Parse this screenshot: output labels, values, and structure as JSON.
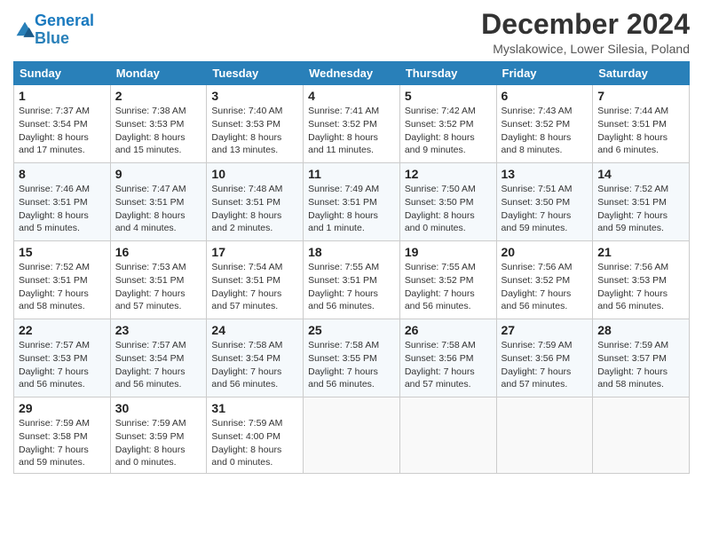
{
  "header": {
    "logo_line1": "General",
    "logo_line2": "Blue",
    "month_title": "December 2024",
    "location": "Myslakowice, Lower Silesia, Poland"
  },
  "weekdays": [
    "Sunday",
    "Monday",
    "Tuesday",
    "Wednesday",
    "Thursday",
    "Friday",
    "Saturday"
  ],
  "weeks": [
    [
      {
        "day": "1",
        "sunrise": "7:37 AM",
        "sunset": "3:54 PM",
        "daylight": "8 hours and 17 minutes."
      },
      {
        "day": "2",
        "sunrise": "7:38 AM",
        "sunset": "3:53 PM",
        "daylight": "8 hours and 15 minutes."
      },
      {
        "day": "3",
        "sunrise": "7:40 AM",
        "sunset": "3:53 PM",
        "daylight": "8 hours and 13 minutes."
      },
      {
        "day": "4",
        "sunrise": "7:41 AM",
        "sunset": "3:52 PM",
        "daylight": "8 hours and 11 minutes."
      },
      {
        "day": "5",
        "sunrise": "7:42 AM",
        "sunset": "3:52 PM",
        "daylight": "8 hours and 9 minutes."
      },
      {
        "day": "6",
        "sunrise": "7:43 AM",
        "sunset": "3:52 PM",
        "daylight": "8 hours and 8 minutes."
      },
      {
        "day": "7",
        "sunrise": "7:44 AM",
        "sunset": "3:51 PM",
        "daylight": "8 hours and 6 minutes."
      }
    ],
    [
      {
        "day": "8",
        "sunrise": "7:46 AM",
        "sunset": "3:51 PM",
        "daylight": "8 hours and 5 minutes."
      },
      {
        "day": "9",
        "sunrise": "7:47 AM",
        "sunset": "3:51 PM",
        "daylight": "8 hours and 4 minutes."
      },
      {
        "day": "10",
        "sunrise": "7:48 AM",
        "sunset": "3:51 PM",
        "daylight": "8 hours and 2 minutes."
      },
      {
        "day": "11",
        "sunrise": "7:49 AM",
        "sunset": "3:51 PM",
        "daylight": "8 hours and 1 minute."
      },
      {
        "day": "12",
        "sunrise": "7:50 AM",
        "sunset": "3:50 PM",
        "daylight": "8 hours and 0 minutes."
      },
      {
        "day": "13",
        "sunrise": "7:51 AM",
        "sunset": "3:50 PM",
        "daylight": "7 hours and 59 minutes."
      },
      {
        "day": "14",
        "sunrise": "7:52 AM",
        "sunset": "3:51 PM",
        "daylight": "7 hours and 59 minutes."
      }
    ],
    [
      {
        "day": "15",
        "sunrise": "7:52 AM",
        "sunset": "3:51 PM",
        "daylight": "7 hours and 58 minutes."
      },
      {
        "day": "16",
        "sunrise": "7:53 AM",
        "sunset": "3:51 PM",
        "daylight": "7 hours and 57 minutes."
      },
      {
        "day": "17",
        "sunrise": "7:54 AM",
        "sunset": "3:51 PM",
        "daylight": "7 hours and 57 minutes."
      },
      {
        "day": "18",
        "sunrise": "7:55 AM",
        "sunset": "3:51 PM",
        "daylight": "7 hours and 56 minutes."
      },
      {
        "day": "19",
        "sunrise": "7:55 AM",
        "sunset": "3:52 PM",
        "daylight": "7 hours and 56 minutes."
      },
      {
        "day": "20",
        "sunrise": "7:56 AM",
        "sunset": "3:52 PM",
        "daylight": "7 hours and 56 minutes."
      },
      {
        "day": "21",
        "sunrise": "7:56 AM",
        "sunset": "3:53 PM",
        "daylight": "7 hours and 56 minutes."
      }
    ],
    [
      {
        "day": "22",
        "sunrise": "7:57 AM",
        "sunset": "3:53 PM",
        "daylight": "7 hours and 56 minutes."
      },
      {
        "day": "23",
        "sunrise": "7:57 AM",
        "sunset": "3:54 PM",
        "daylight": "7 hours and 56 minutes."
      },
      {
        "day": "24",
        "sunrise": "7:58 AM",
        "sunset": "3:54 PM",
        "daylight": "7 hours and 56 minutes."
      },
      {
        "day": "25",
        "sunrise": "7:58 AM",
        "sunset": "3:55 PM",
        "daylight": "7 hours and 56 minutes."
      },
      {
        "day": "26",
        "sunrise": "7:58 AM",
        "sunset": "3:56 PM",
        "daylight": "7 hours and 57 minutes."
      },
      {
        "day": "27",
        "sunrise": "7:59 AM",
        "sunset": "3:56 PM",
        "daylight": "7 hours and 57 minutes."
      },
      {
        "day": "28",
        "sunrise": "7:59 AM",
        "sunset": "3:57 PM",
        "daylight": "7 hours and 58 minutes."
      }
    ],
    [
      {
        "day": "29",
        "sunrise": "7:59 AM",
        "sunset": "3:58 PM",
        "daylight": "7 hours and 59 minutes."
      },
      {
        "day": "30",
        "sunrise": "7:59 AM",
        "sunset": "3:59 PM",
        "daylight": "8 hours and 0 minutes."
      },
      {
        "day": "31",
        "sunrise": "7:59 AM",
        "sunset": "4:00 PM",
        "daylight": "8 hours and 0 minutes."
      },
      null,
      null,
      null,
      null
    ]
  ]
}
